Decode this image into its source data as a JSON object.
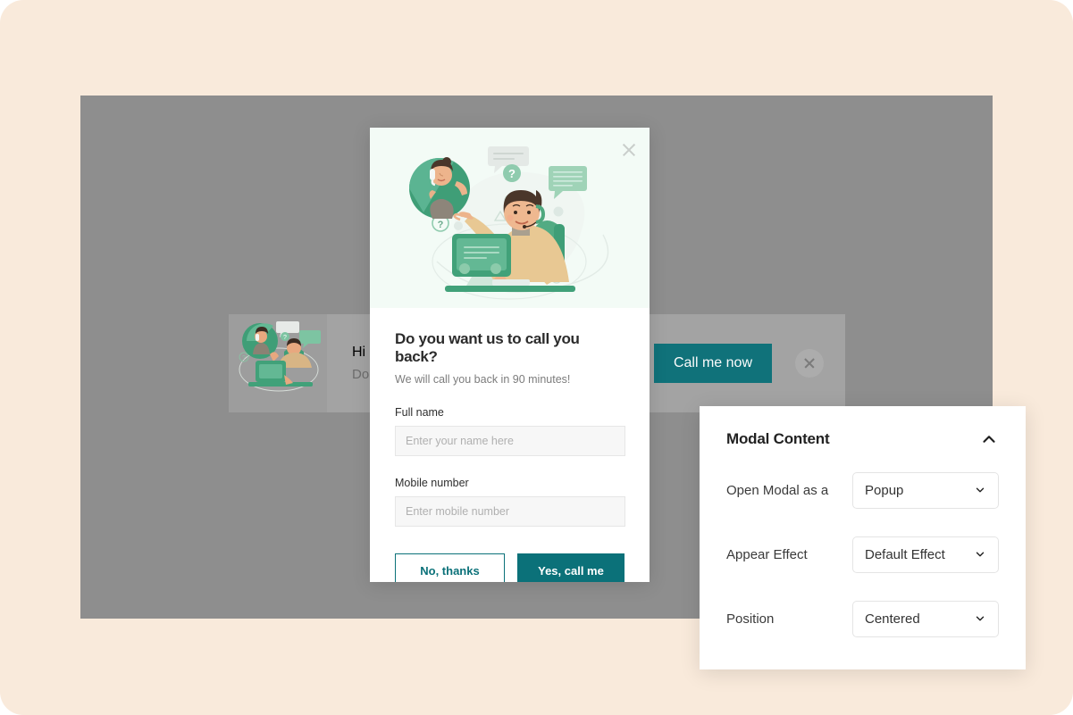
{
  "theme": {
    "canvas_bg": "#f9eadb",
    "overlay_gray": "#8e8e8e",
    "accent_teal": "#0b7179",
    "hero_mint": "#f3fbf6"
  },
  "background_banner": {
    "title": "Hi",
    "subtitle": "Do",
    "cta_label": "Call me now",
    "close_icon": "close-icon",
    "thumbnail_icon": "callback-illustration-thumbnail"
  },
  "modal": {
    "close_icon": "close-icon",
    "hero_illustration": "customer-support-agent-illustration",
    "title": "Do you want us to call you back?",
    "subtitle": "We will call you back in 90 minutes!",
    "fields": [
      {
        "label": "Full name",
        "value": "",
        "placeholder": "Enter your name here"
      },
      {
        "label": "Mobile number",
        "value": "",
        "placeholder": "Enter mobile number"
      }
    ],
    "decline_label": "No, thanks",
    "accept_label": "Yes, call me"
  },
  "settings_panel": {
    "title": "Modal Content",
    "collapse_icon": "chevron-up-icon",
    "rows": [
      {
        "label": "Open Modal as a",
        "value": "Popup",
        "icon": "chevron-down-icon"
      },
      {
        "label": "Appear Effect",
        "value": "Default Effect",
        "icon": "chevron-down-icon"
      },
      {
        "label": "Position",
        "value": "Centered",
        "icon": "chevron-down-icon"
      }
    ]
  }
}
